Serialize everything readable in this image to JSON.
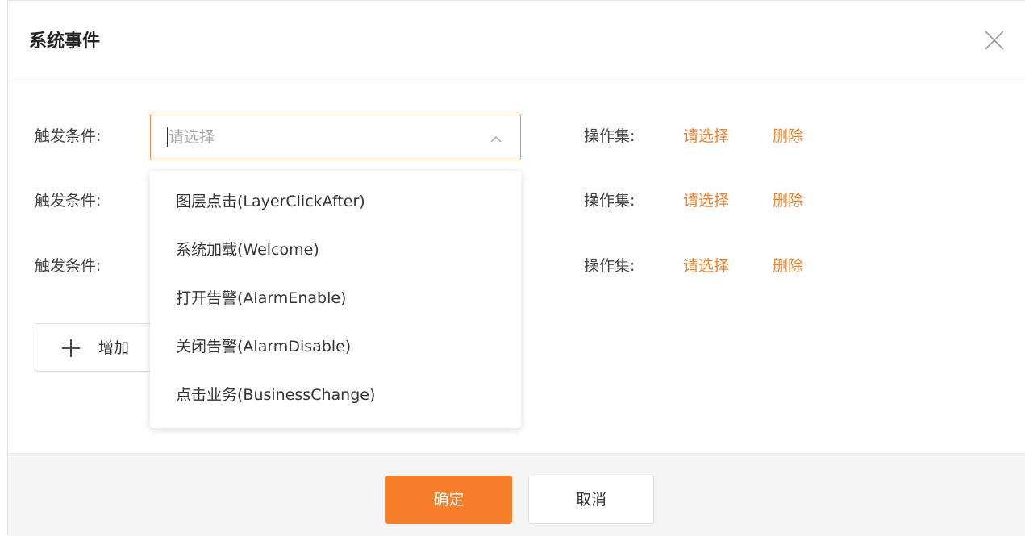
{
  "dialog": {
    "title": "系统事件",
    "close_icon": "close-icon"
  },
  "rows": [
    {
      "trigger_label": "触发条件:",
      "select_placeholder": "请选择",
      "ops_label": "操作集:",
      "ops_choose": "请选择",
      "delete_label": "删除"
    },
    {
      "trigger_label": "触发条件:",
      "ops_label": "操作集:",
      "ops_choose": "请选择",
      "delete_label": "删除"
    },
    {
      "trigger_label": "触发条件:",
      "ops_label": "操作集:",
      "ops_choose": "请选择",
      "delete_label": "删除"
    }
  ],
  "add_button": {
    "label": "增加",
    "icon": "plus-icon"
  },
  "dropdown": {
    "options": [
      "图层点击(LayerClickAfter)",
      "系统加载(Welcome)",
      "打开告警(AlarmEnable)",
      "关闭告警(AlarmDisable)",
      "点击业务(BusinessChange)"
    ]
  },
  "footer": {
    "ok_label": "确定",
    "cancel_label": "取消"
  },
  "colors": {
    "accent": "#f5812b",
    "primary_button": "#f77f2a",
    "footer_bg": "#f5f5f5"
  }
}
